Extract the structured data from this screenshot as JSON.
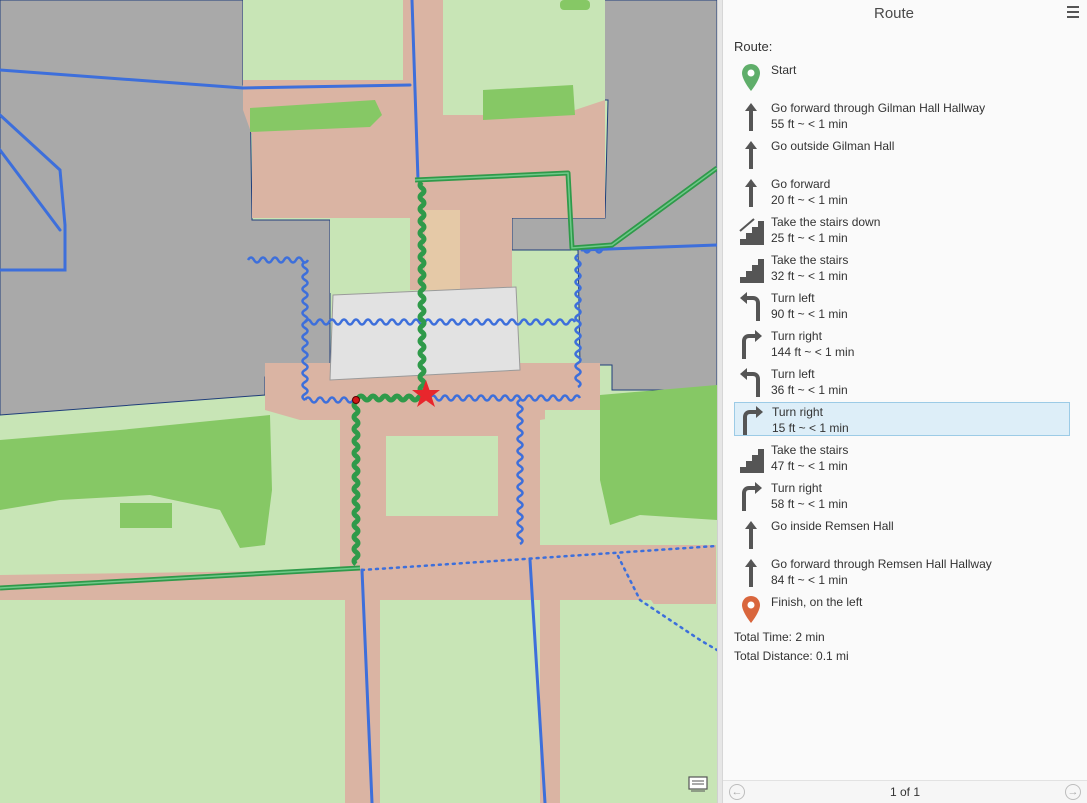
{
  "panel": {
    "title": "Route",
    "route_label": "Route:",
    "steps": [
      {
        "icon": "start-pin-icon",
        "line1": "Start",
        "line2": ""
      },
      {
        "icon": "arrow-up-icon",
        "line1": "Go forward through Gilman Hall Hallway",
        "line2": "55 ft ~ < 1 min"
      },
      {
        "icon": "arrow-up-icon",
        "line1": "Go outside Gilman Hall",
        "line2": ""
      },
      {
        "icon": "arrow-up-icon",
        "line1": "Go forward",
        "line2": "20 ft ~ < 1 min"
      },
      {
        "icon": "stairs-down-icon",
        "line1": "Take the stairs down",
        "line2": "25 ft ~ < 1 min"
      },
      {
        "icon": "stairs-icon",
        "line1": "Take the stairs",
        "line2": "32 ft ~ < 1 min"
      },
      {
        "icon": "turn-left-icon",
        "line1": "Turn left",
        "line2": "90 ft ~ < 1 min"
      },
      {
        "icon": "turn-right-icon",
        "line1": "Turn right",
        "line2": "144 ft ~ < 1 min"
      },
      {
        "icon": "turn-left-icon",
        "line1": "Turn left",
        "line2": "36 ft ~ < 1 min"
      },
      {
        "icon": "turn-right-icon",
        "line1": "Turn right",
        "line2": "15 ft ~ < 1 min",
        "selected": true
      },
      {
        "icon": "stairs-icon",
        "line1": "Take the stairs",
        "line2": "47 ft ~ < 1 min"
      },
      {
        "icon": "turn-right-icon",
        "line1": "Turn right",
        "line2": "58 ft ~ < 1 min"
      },
      {
        "icon": "arrow-up-icon",
        "line1": "Go inside Remsen Hall",
        "line2": ""
      },
      {
        "icon": "arrow-up-icon",
        "line1": "Go forward through Remsen Hall Hallway",
        "line2": "84 ft ~ < 1 min"
      },
      {
        "icon": "finish-pin-icon",
        "line1": "Finish, on the left",
        "line2": ""
      }
    ],
    "total_time": "Total Time: 2 min",
    "total_distance": "Total Distance: 0.1 mi",
    "pager": "1 of 1",
    "prev_icon": "arrow-left-circle-icon",
    "next_icon": "arrow-right-circle-icon",
    "menu_icon": "hamburger-menu-icon"
  },
  "map": {
    "colors": {
      "grass": "#c8e5b6",
      "dark_grass": "#86c865",
      "building": "#aaaaaa",
      "walkway": "#dab4a3",
      "plaza": "#e2e2e2",
      "path": "#3d6fdb",
      "route": "#2f9a4a",
      "star": "#e8262c"
    },
    "tool_icon": "map-tips-icon"
  }
}
